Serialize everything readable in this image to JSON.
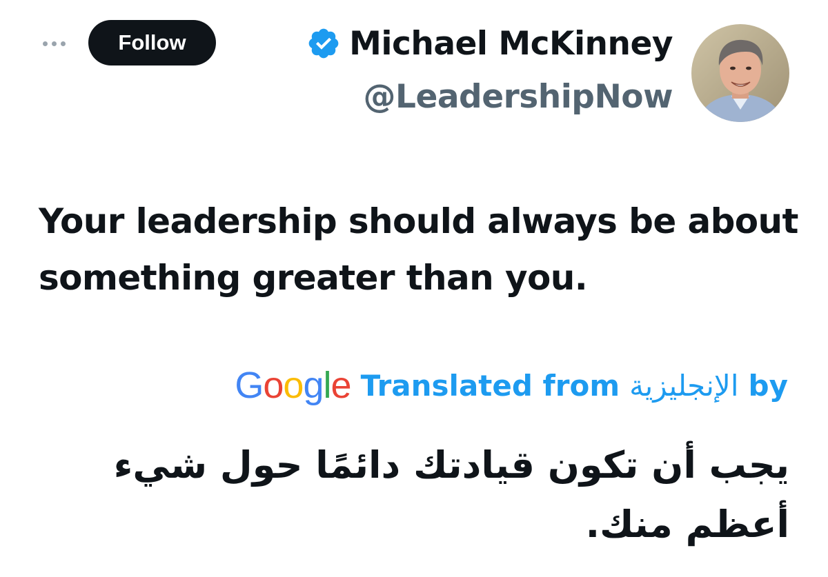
{
  "header": {
    "more_icon": "more-horizontal-icon",
    "follow_label": "Follow",
    "display_name": "Michael McKinney",
    "verified_icon": "verified-badge-icon",
    "handle": "@LeadershipNow",
    "avatar_icon": "user-avatar"
  },
  "tweet": {
    "text": "Your leadership should always be about something greater than you."
  },
  "translation": {
    "logo_letters": [
      "G",
      "o",
      "o",
      "g",
      "l",
      "e"
    ],
    "translated_from_label": "Translated from",
    "language_name": "الإنجليزية",
    "by_label": "by",
    "text": "يجب أن تكون قيادتك دائمًا حول شيء أعظم منك."
  },
  "colors": {
    "text": "#0f1419",
    "secondary_text": "#536471",
    "accent": "#1d9bf0",
    "verified": "#1d9bf0",
    "google_blue": "#4285F4",
    "google_red": "#EA4335",
    "google_yellow": "#FBBC05",
    "google_green": "#34A853"
  }
}
